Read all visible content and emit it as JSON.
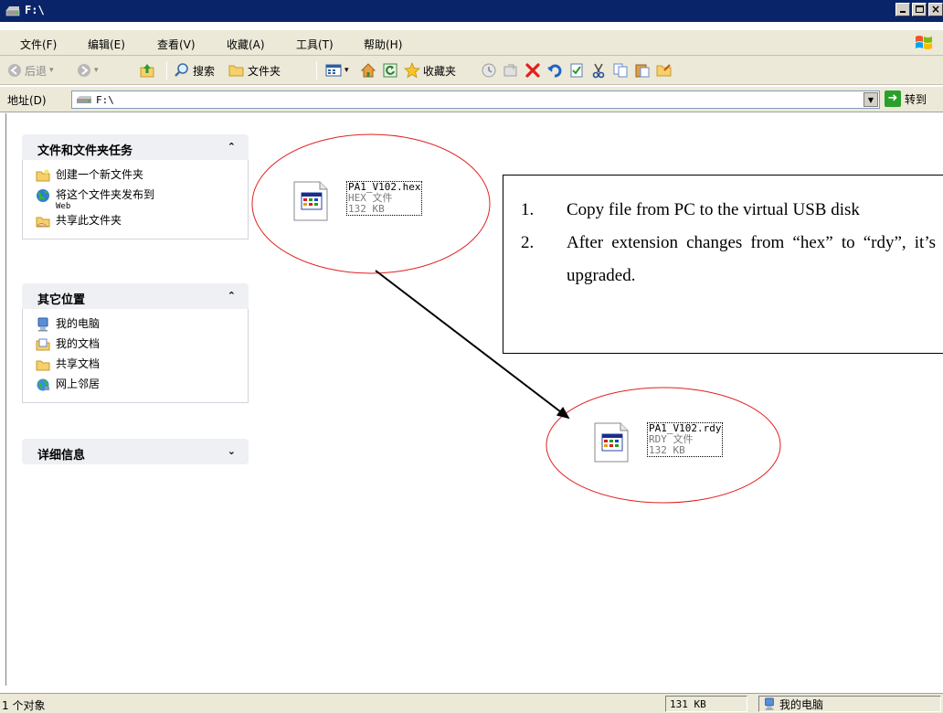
{
  "window": {
    "title": "F:\\"
  },
  "menu": [
    "文件(F)",
    "编辑(E)",
    "查看(V)",
    "收藏(A)",
    "工具(T)",
    "帮助(H)"
  ],
  "toolbar": {
    "back": "后退",
    "search": "搜索",
    "folders": "文件夹",
    "favorites": "收藏夹"
  },
  "address": {
    "label": "地址(D)",
    "value": "F:\\",
    "go": "转到"
  },
  "tasks": {
    "file_tasks": {
      "title": "文件和文件夹任务",
      "items": [
        "创建一个新文件夹",
        "将这个文件夹发布到",
        "共享此文件夹"
      ],
      "publish_sub": "Web"
    },
    "other_places": {
      "title": "其它位置",
      "items": [
        "我的电脑",
        "我的文档",
        "共享文档",
        "网上邻居"
      ]
    },
    "details": {
      "title": "详细信息"
    }
  },
  "files": [
    {
      "name": "PA1_V102.hex",
      "type": "HEX 文件",
      "size": "132 KB"
    },
    {
      "name": "PA1_V102.rdy",
      "type": "RDY 文件",
      "size": "132 KB"
    }
  ],
  "note": {
    "items": [
      {
        "num": "1.",
        "text": "Copy file from PC to the virtual USB disk"
      },
      {
        "num": "2.",
        "text": "After extension changes from “hex” to “rdy”, it’s upgraded."
      }
    ]
  },
  "status": {
    "objects": "1 个对象",
    "size": "131 KB",
    "zone": "我的电脑"
  },
  "colors": {
    "title_bar": "#0a246a",
    "chrome": "#ece9d8",
    "annotation": "#e02020"
  }
}
